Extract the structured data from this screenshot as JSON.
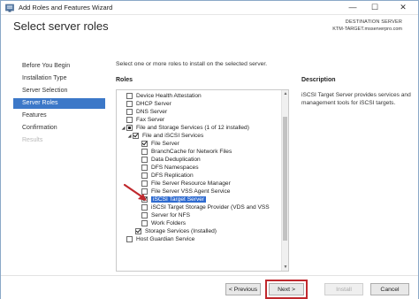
{
  "window": {
    "title": "Add Roles and Features Wizard",
    "controls": {
      "minimize": "—",
      "maximize": "☐",
      "close": "✕"
    }
  },
  "header": {
    "title": "Select server roles",
    "destination_label": "DESTINATION SERVER",
    "destination_value": "KTM-TARGET.msserverpro.com"
  },
  "nav": {
    "items": [
      {
        "label": "Before You Begin",
        "state": "normal"
      },
      {
        "label": "Installation Type",
        "state": "normal"
      },
      {
        "label": "Server Selection",
        "state": "normal"
      },
      {
        "label": "Server Roles",
        "state": "active"
      },
      {
        "label": "Features",
        "state": "normal"
      },
      {
        "label": "Confirmation",
        "state": "normal"
      },
      {
        "label": "Results",
        "state": "disabled"
      }
    ]
  },
  "main": {
    "instruction": "Select one or more roles to install on the selected server.",
    "roles_header": "Roles",
    "description_header": "Description",
    "description": "iSCSI Target Server provides services and management tools for iSCSI targets.",
    "roles": [
      {
        "label": "Device Health Attestation",
        "checked": "none"
      },
      {
        "label": "DHCP Server",
        "checked": "none"
      },
      {
        "label": "DNS Server",
        "checked": "none"
      },
      {
        "label": "Fax Server",
        "checked": "none"
      },
      {
        "label": "File and Storage Services (1 of 12 installed)",
        "checked": "partial",
        "expander": "◢"
      },
      {
        "label": "File and iSCSI Services",
        "checked": "checked",
        "expander": "◢"
      },
      {
        "label": "File Server",
        "checked": "checked"
      },
      {
        "label": "BranchCache for Network Files",
        "checked": "none"
      },
      {
        "label": "Data Deduplication",
        "checked": "none"
      },
      {
        "label": "DFS Namespaces",
        "checked": "none"
      },
      {
        "label": "DFS Replication",
        "checked": "none"
      },
      {
        "label": "File Server Resource Manager",
        "checked": "none"
      },
      {
        "label": "File Server VSS Agent Service",
        "checked": "none"
      },
      {
        "label": "iSCSI Target Server",
        "checked": "checked",
        "selected": true
      },
      {
        "label": "iSCSI Target Storage Provider (VDS and VSS",
        "checked": "none"
      },
      {
        "label": "Server for NFS",
        "checked": "none"
      },
      {
        "label": "Work Folders",
        "checked": "none"
      },
      {
        "label": "Storage Services (Installed)",
        "checked": "checked"
      },
      {
        "label": "Host Guardian Service",
        "checked": "none"
      }
    ]
  },
  "footer": {
    "previous": "< Previous",
    "next": "Next >",
    "install": "Install",
    "cancel": "Cancel"
  },
  "colors": {
    "nav_active": "#3c78c8",
    "selection": "#2f6bd0",
    "highlight_red": "#c0282d"
  }
}
